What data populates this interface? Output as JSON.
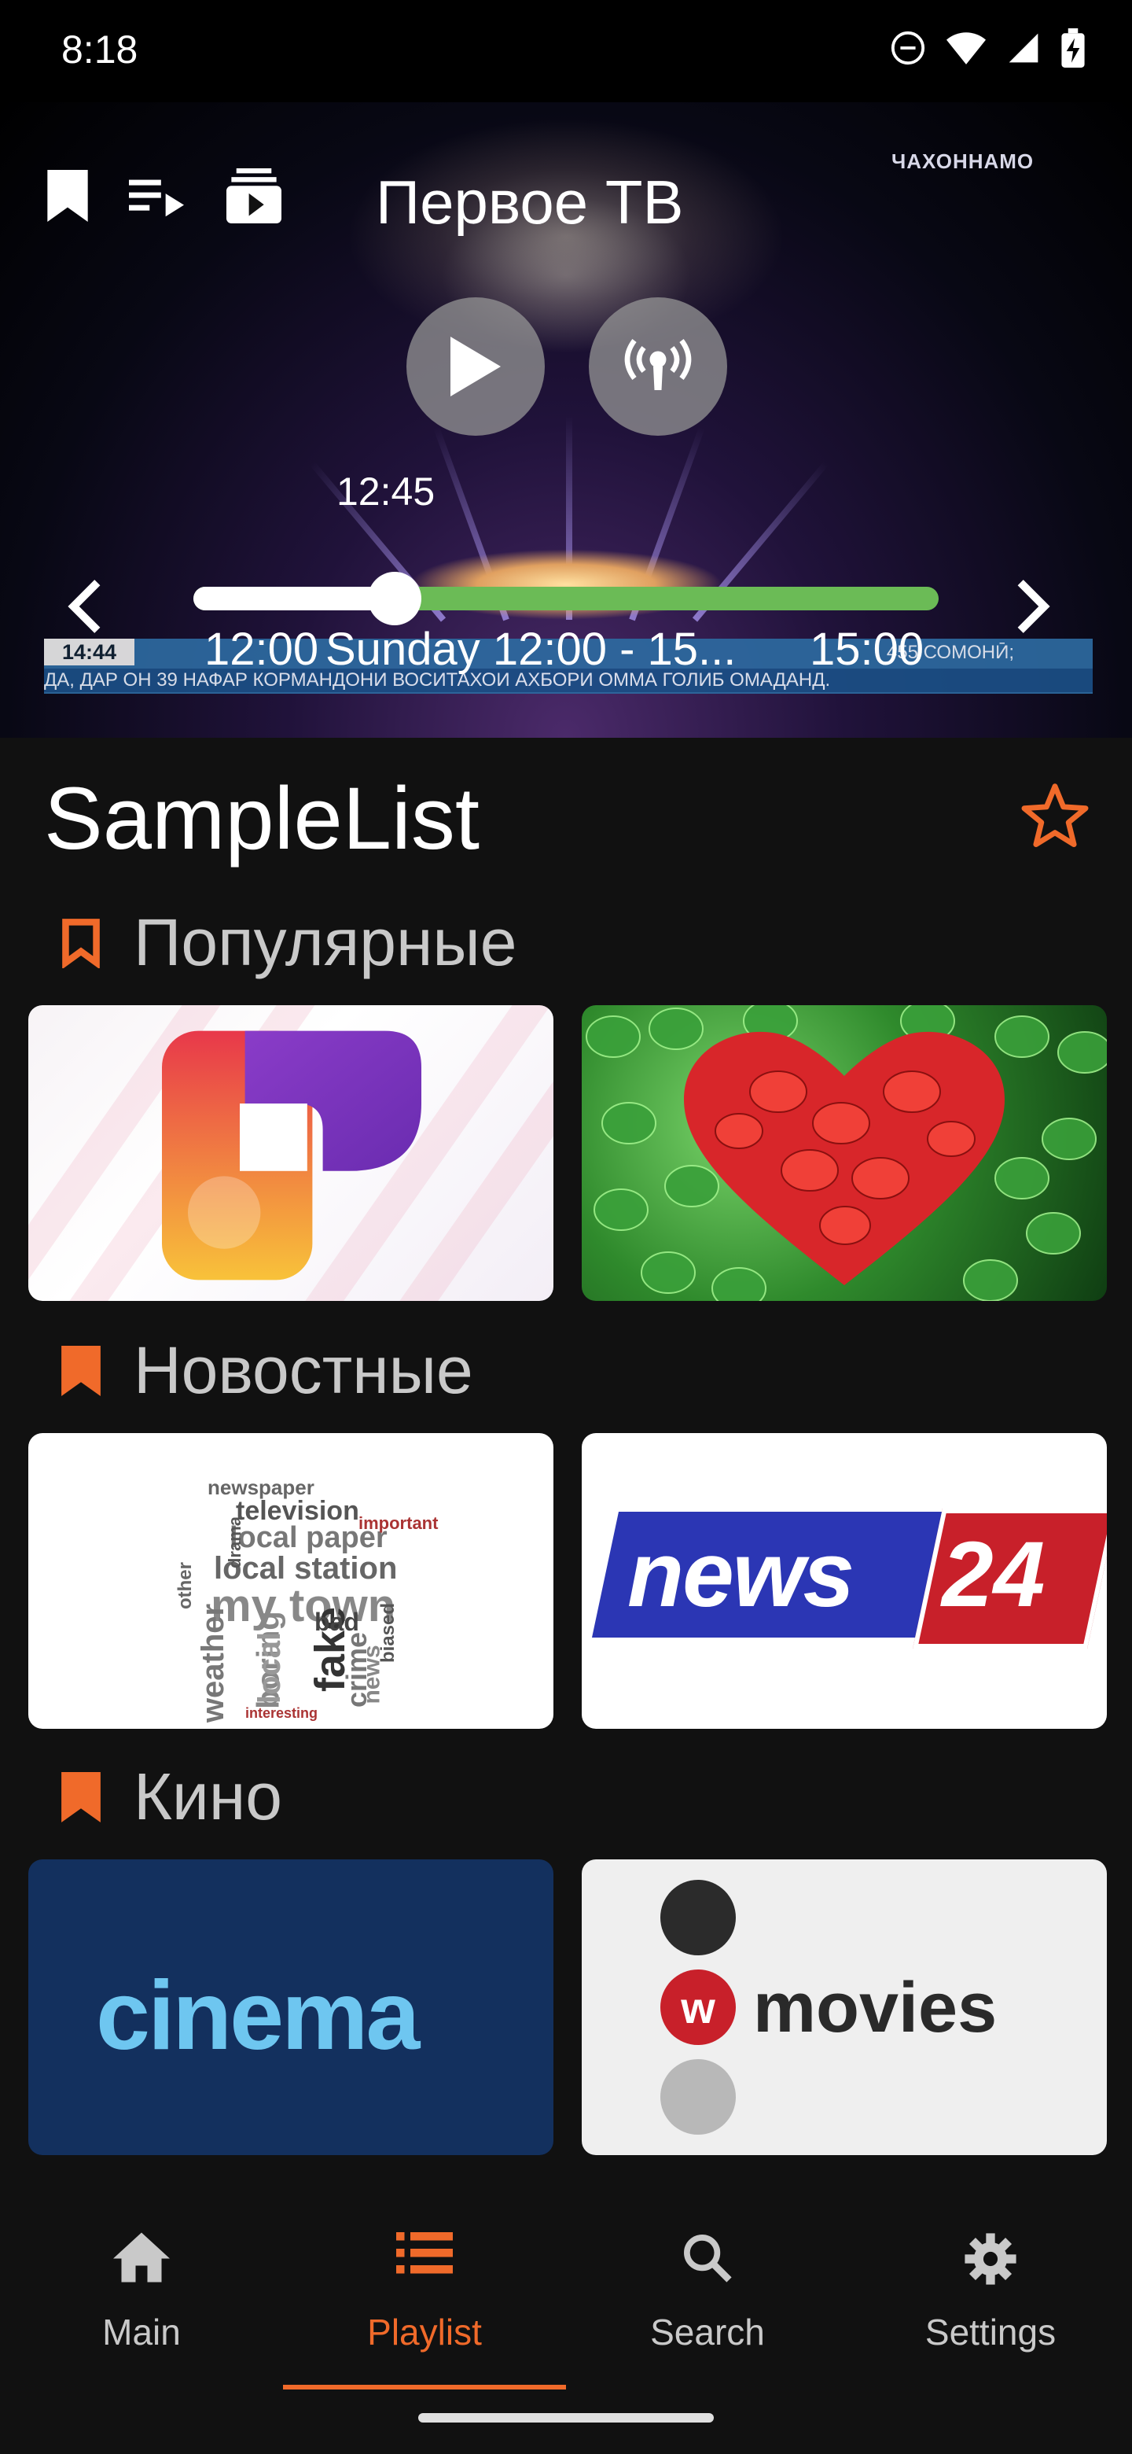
{
  "status_bar": {
    "time": "8:18",
    "icons": [
      "dnd-icon",
      "wifi-icon",
      "signal-icon",
      "battery-charging-icon"
    ]
  },
  "player": {
    "channel_title": "Первое ТВ",
    "watermark": "ЧАХОННАМО",
    "current_time": "12:45",
    "epg_start": "12:00",
    "epg_title": "Sunday 12:00 - 15...",
    "epg_end": "15:00",
    "progress_fraction": 0.27,
    "ticker_time": "14:44",
    "ticker_text": "ДА, ДАР ОН 39 НАФАР КОРМАНДОНИ ВОСИТАХОИ АХБОРИ ОММА ГОЛИБ ОМАДАНД.",
    "ticker_right": "455 СОМОНӢ;",
    "icons": [
      "bookmark-icon",
      "playlist-play-icon",
      "subscriptions-icon",
      "play-icon",
      "live-broadcast-icon",
      "chevron-left-icon",
      "chevron-right-icon"
    ]
  },
  "list": {
    "title": "SampleList",
    "sections": [
      {
        "label": "Популярные",
        "cards": [
          "Первый канал",
          "Heart"
        ]
      },
      {
        "label": "Новостные",
        "cards": [
          "my town",
          "news24"
        ]
      },
      {
        "label": "Кино",
        "cards": [
          "cinema",
          "movies"
        ]
      }
    ]
  },
  "cards": {
    "news_word": "news",
    "news_num": "24",
    "cinema_text": "cinema",
    "movies_text": "movies",
    "movies_w": "w",
    "word_cloud": [
      "my town",
      "local station",
      "local paper",
      "television",
      "newspaper",
      "fake",
      "bad",
      "weather",
      "boring",
      "local",
      "crime",
      "news",
      "important",
      "interesting",
      "drama",
      "other",
      "biased"
    ]
  },
  "bottom_nav": {
    "items": [
      {
        "label": "Main",
        "icon": "home-icon"
      },
      {
        "label": "Playlist",
        "icon": "list-icon"
      },
      {
        "label": "Search",
        "icon": "search-icon"
      },
      {
        "label": "Settings",
        "icon": "gear-icon"
      }
    ],
    "active": "Playlist"
  },
  "colors": {
    "accent": "#f06a2a",
    "progress_done": "#ffffff",
    "progress_rest": "#6bbb56",
    "background": "#111111"
  }
}
